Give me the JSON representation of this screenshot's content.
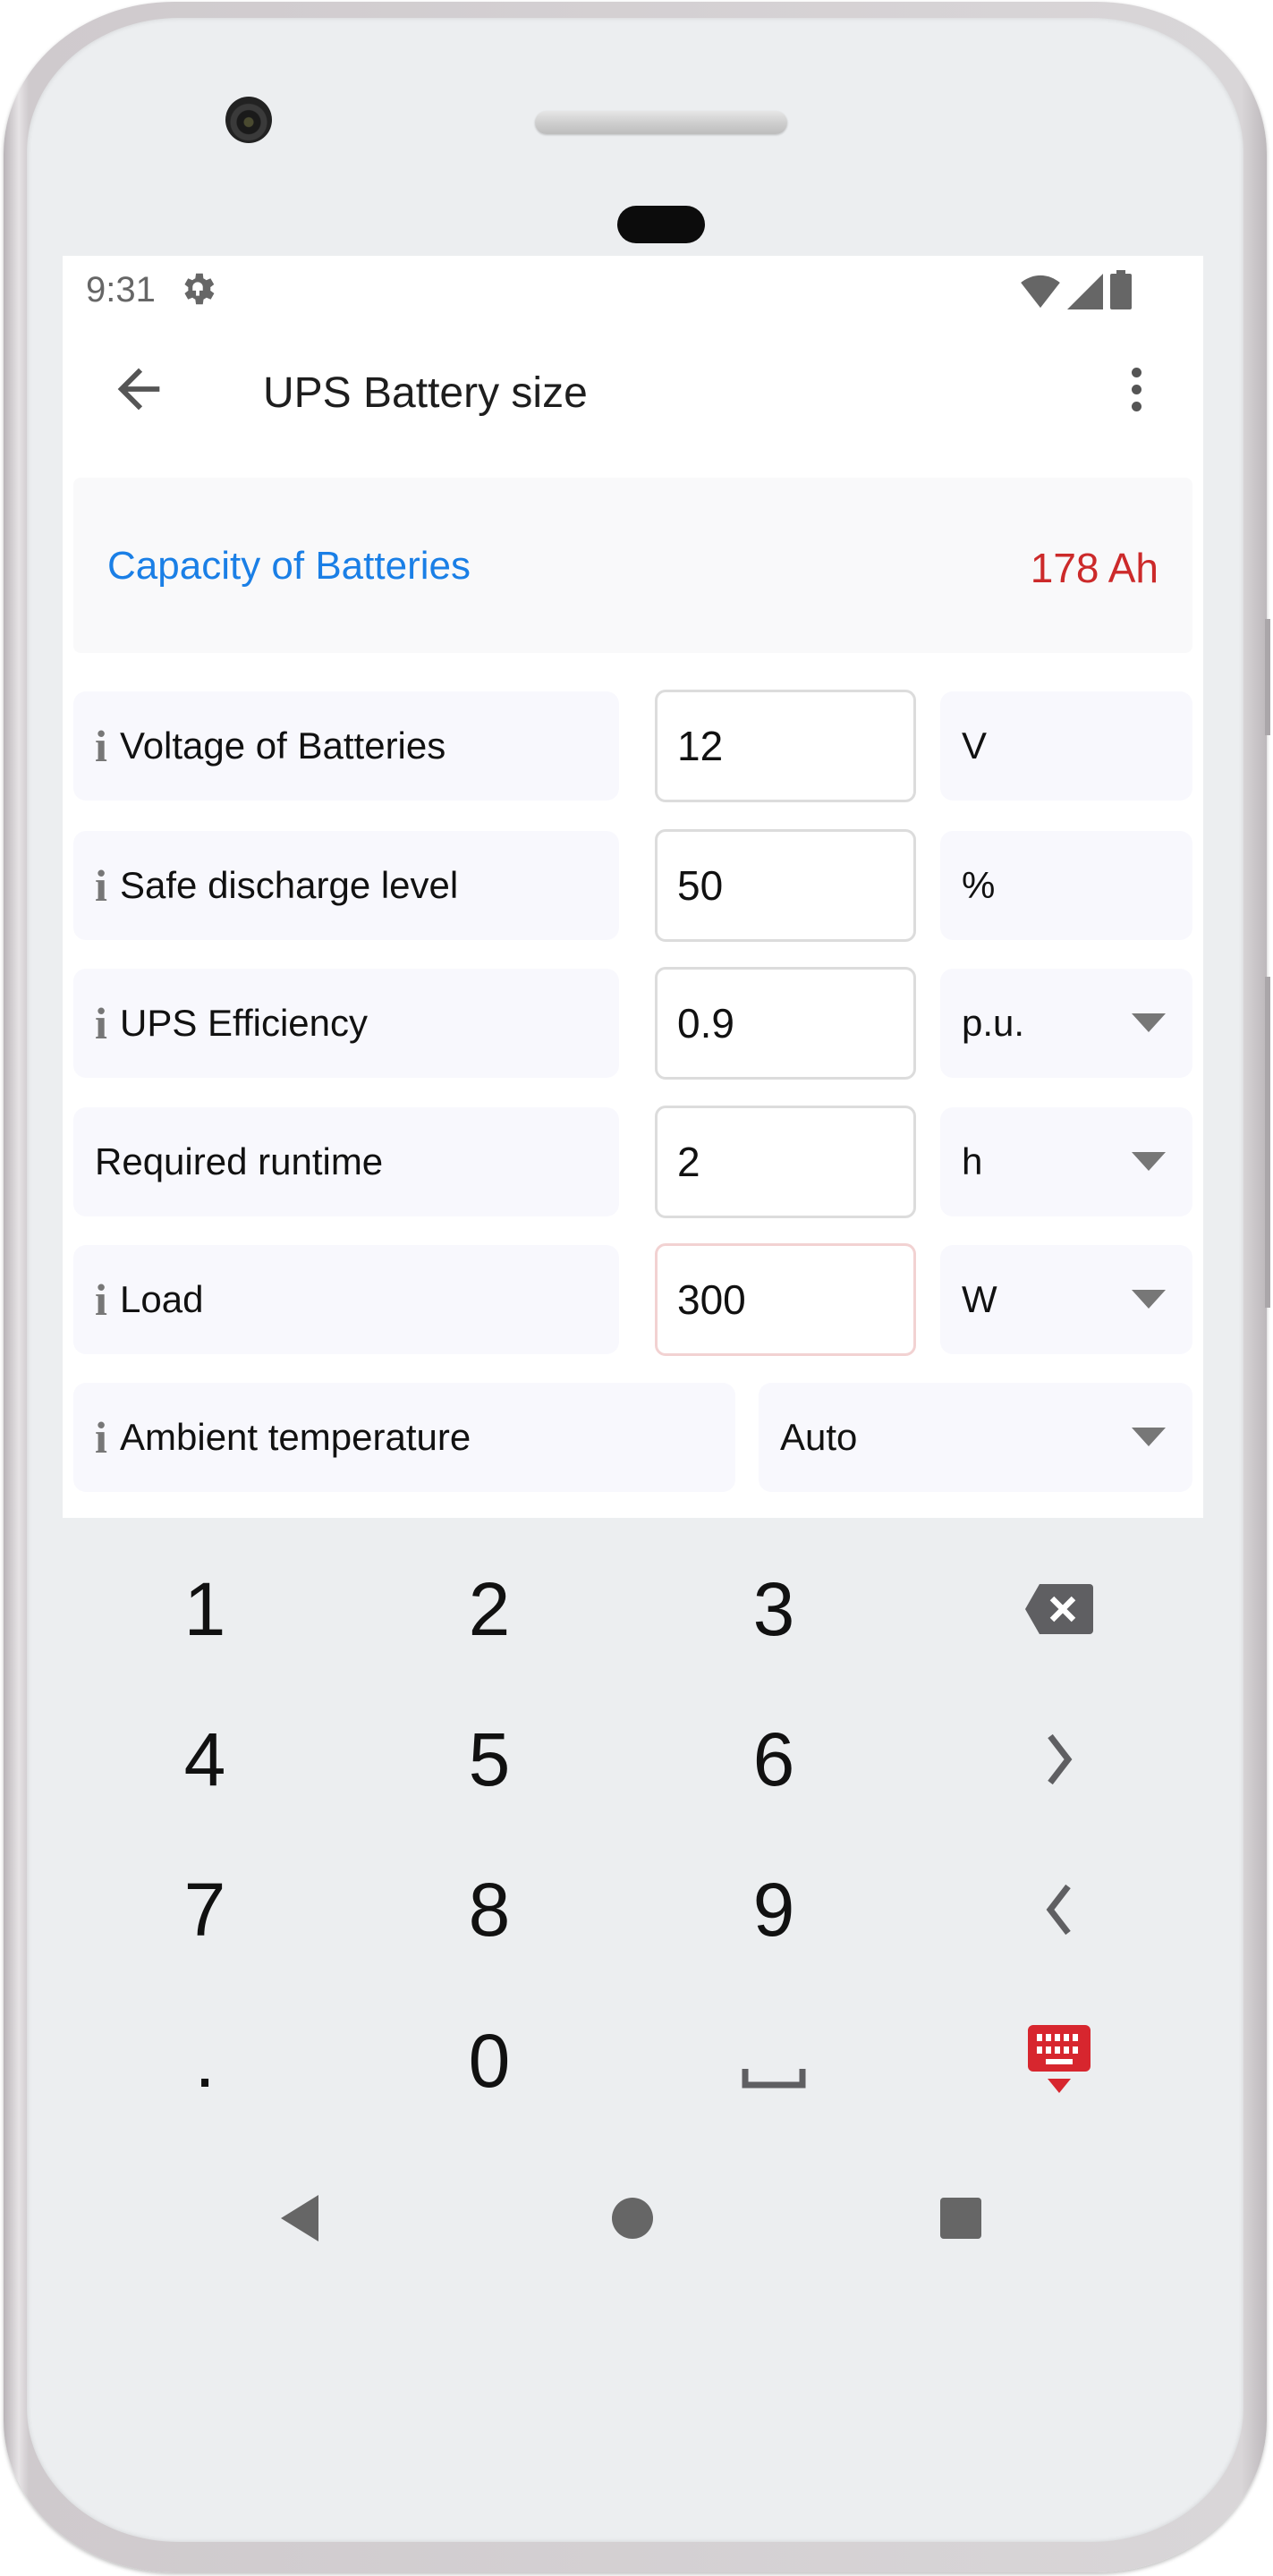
{
  "status_bar": {
    "time": "9:31",
    "icons": [
      "settings-gear-icon",
      "wifi-icon",
      "cellular-signal-icon",
      "battery-icon"
    ]
  },
  "app_bar": {
    "title": "UPS Battery size",
    "back_icon": "arrow-left-icon",
    "menu_icon": "more-vertical-icon"
  },
  "result": {
    "label": "Capacity of Batteries",
    "value": "178 Ah",
    "label_color": "#1a7fe6",
    "value_color": "#cc2a2a"
  },
  "fields": [
    {
      "label": "Voltage of Batteries",
      "info": true,
      "value": "12",
      "unit": "V",
      "unit_dropdown": false
    },
    {
      "label": "Safe discharge level",
      "info": true,
      "value": "50",
      "unit": "%",
      "unit_dropdown": false
    },
    {
      "label": "UPS Efficiency",
      "info": true,
      "value": "0.9",
      "unit": "p.u.",
      "unit_dropdown": true
    },
    {
      "label": "Required runtime",
      "info": false,
      "value": "2",
      "unit": "h",
      "unit_dropdown": true
    },
    {
      "label": "Load",
      "info": true,
      "value": "300",
      "unit": "W",
      "unit_dropdown": true,
      "focused": true
    }
  ],
  "ambient": {
    "label": "Ambient temperature",
    "info": true,
    "selected": "Auto"
  },
  "info_glyph": "i",
  "keyboard": {
    "keys": [
      [
        "1",
        "2",
        "3",
        "backspace"
      ],
      [
        "4",
        "5",
        "6",
        "cursor-right"
      ],
      [
        "7",
        "8",
        "9",
        "cursor-left"
      ],
      [
        ".",
        "0",
        "space",
        "hide-keyboard"
      ]
    ],
    "labels": {
      "1": "1",
      "2": "2",
      "3": "3",
      "4": "4",
      "5": "5",
      "6": "6",
      "7": "7",
      "8": "8",
      "9": "9",
      "0": "0",
      "dot": "."
    },
    "accent_color": "#d7262e"
  },
  "nav_bar": [
    "back",
    "home",
    "recents"
  ]
}
